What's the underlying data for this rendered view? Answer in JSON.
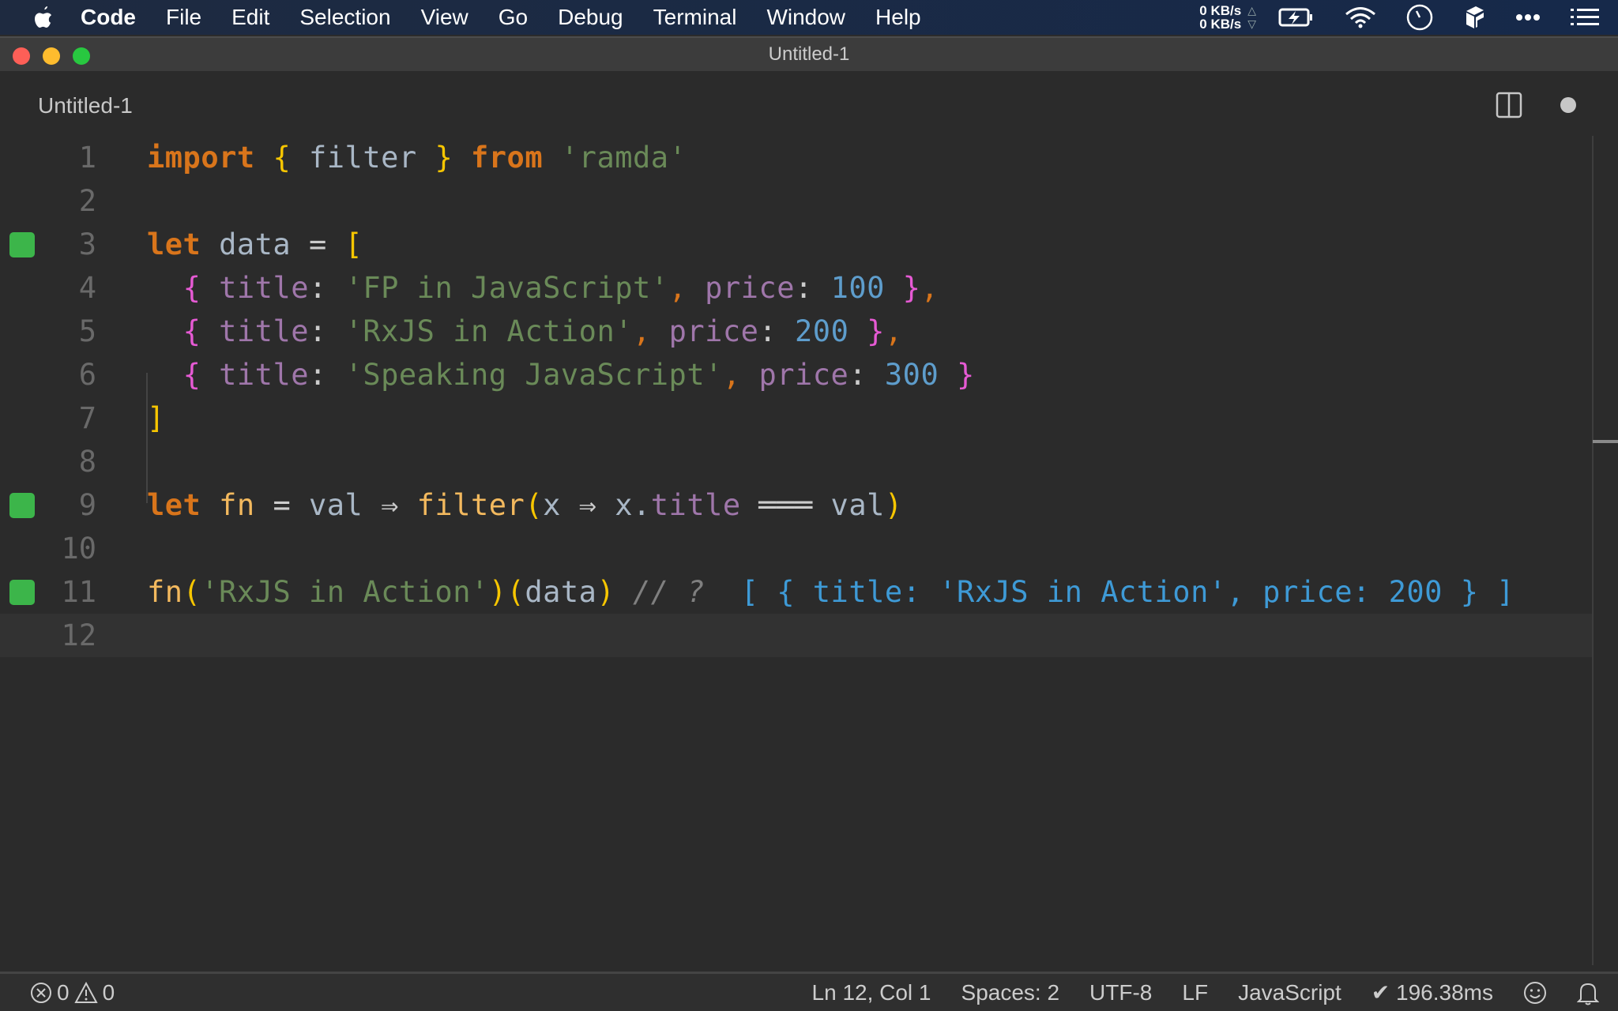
{
  "menubar": {
    "app_name": "Code",
    "items": [
      "File",
      "Edit",
      "Selection",
      "View",
      "Go",
      "Debug",
      "Terminal",
      "Window",
      "Help"
    ],
    "network": {
      "upload": "0 KB/s",
      "download": "0 KB/s"
    },
    "status_icons": [
      "battery-charging-icon",
      "wifi-icon",
      "clock-icon",
      "box-icon",
      "more-icon",
      "list-icon"
    ]
  },
  "window": {
    "title": "Untitled-1",
    "traffic_lights": {
      "close": "#fe5f57",
      "minimize": "#febc2e",
      "zoom": "#28c840"
    }
  },
  "tab": {
    "label": "Untitled-1",
    "dirty": true
  },
  "editor": {
    "current_line": 12,
    "lines": [
      {
        "n": "1",
        "marker": false,
        "tokens": [
          [
            "k",
            "import"
          ],
          [
            "op",
            " "
          ],
          [
            "br",
            "{"
          ],
          [
            "id",
            " filter "
          ],
          [
            "br",
            "}"
          ],
          [
            "op",
            " "
          ],
          [
            "k",
            "from"
          ],
          [
            "op",
            " "
          ],
          [
            "str",
            "'ramda'"
          ]
        ]
      },
      {
        "n": "2",
        "marker": false,
        "tokens": []
      },
      {
        "n": "3",
        "marker": true,
        "tokens": [
          [
            "k",
            "let"
          ],
          [
            "id",
            " data "
          ],
          [
            "op",
            "="
          ],
          [
            "op",
            " "
          ],
          [
            "br",
            "["
          ]
        ]
      },
      {
        "n": "4",
        "marker": false,
        "tokens": [
          [
            "op",
            "  "
          ],
          [
            "brp",
            "{"
          ],
          [
            "op",
            " "
          ],
          [
            "prop",
            "title"
          ],
          [
            "op",
            ": "
          ],
          [
            "str",
            "'FP in JavaScript'"
          ],
          [
            "punc",
            ","
          ],
          [
            "op",
            " "
          ],
          [
            "prop",
            "price"
          ],
          [
            "op",
            ": "
          ],
          [
            "num",
            "100"
          ],
          [
            "op",
            " "
          ],
          [
            "brp",
            "}"
          ],
          [
            "punc",
            ","
          ]
        ]
      },
      {
        "n": "5",
        "marker": false,
        "tokens": [
          [
            "op",
            "  "
          ],
          [
            "brp",
            "{"
          ],
          [
            "op",
            " "
          ],
          [
            "prop",
            "title"
          ],
          [
            "op",
            ": "
          ],
          [
            "str",
            "'RxJS in Action'"
          ],
          [
            "punc",
            ","
          ],
          [
            "op",
            " "
          ],
          [
            "prop",
            "price"
          ],
          [
            "op",
            ": "
          ],
          [
            "num",
            "200"
          ],
          [
            "op",
            " "
          ],
          [
            "brp",
            "}"
          ],
          [
            "punc",
            ","
          ]
        ]
      },
      {
        "n": "6",
        "marker": false,
        "tokens": [
          [
            "op",
            "  "
          ],
          [
            "brp",
            "{"
          ],
          [
            "op",
            " "
          ],
          [
            "prop",
            "title"
          ],
          [
            "op",
            ": "
          ],
          [
            "str",
            "'Speaking JavaScript'"
          ],
          [
            "punc",
            ","
          ],
          [
            "op",
            " "
          ],
          [
            "prop",
            "price"
          ],
          [
            "op",
            ": "
          ],
          [
            "num",
            "300"
          ],
          [
            "op",
            " "
          ],
          [
            "brp",
            "}"
          ]
        ]
      },
      {
        "n": "7",
        "marker": false,
        "tokens": [
          [
            "br",
            "]"
          ]
        ]
      },
      {
        "n": "8",
        "marker": false,
        "tokens": []
      },
      {
        "n": "9",
        "marker": true,
        "tokens": [
          [
            "k",
            "let"
          ],
          [
            "op",
            " "
          ],
          [
            "fn",
            "fn"
          ],
          [
            "op",
            " = "
          ],
          [
            "id",
            "val"
          ],
          [
            "op",
            " ⇒ "
          ],
          [
            "fn",
            "filter"
          ],
          [
            "br",
            "("
          ],
          [
            "id",
            "x"
          ],
          [
            "op",
            " ⇒ "
          ],
          [
            "id",
            "x."
          ],
          [
            "prop",
            "title"
          ],
          [
            "op",
            " ═══ "
          ],
          [
            "id",
            "val"
          ],
          [
            "br",
            ")"
          ]
        ]
      },
      {
        "n": "10",
        "marker": false,
        "tokens": []
      },
      {
        "n": "11",
        "marker": true,
        "tokens": [
          [
            "fn",
            "fn"
          ],
          [
            "br",
            "("
          ],
          [
            "str",
            "'RxJS in Action'"
          ],
          [
            "br",
            ")"
          ],
          [
            "br",
            "("
          ],
          [
            "id",
            "data"
          ],
          [
            "br",
            ")"
          ],
          [
            "op",
            " "
          ],
          [
            "cm",
            "// ?"
          ],
          [
            "op",
            "  "
          ],
          [
            "res",
            "[ { title: 'RxJS in Action', price: 200 } ]"
          ]
        ]
      },
      {
        "n": "12",
        "marker": false,
        "tokens": []
      }
    ]
  },
  "statusbar": {
    "errors": "0",
    "warnings": "0",
    "position": "Ln 12, Col 1",
    "indent": "Spaces: 2",
    "encoding": "UTF-8",
    "eol": "LF",
    "language": "JavaScript",
    "timing": "✔ 196.38ms"
  }
}
